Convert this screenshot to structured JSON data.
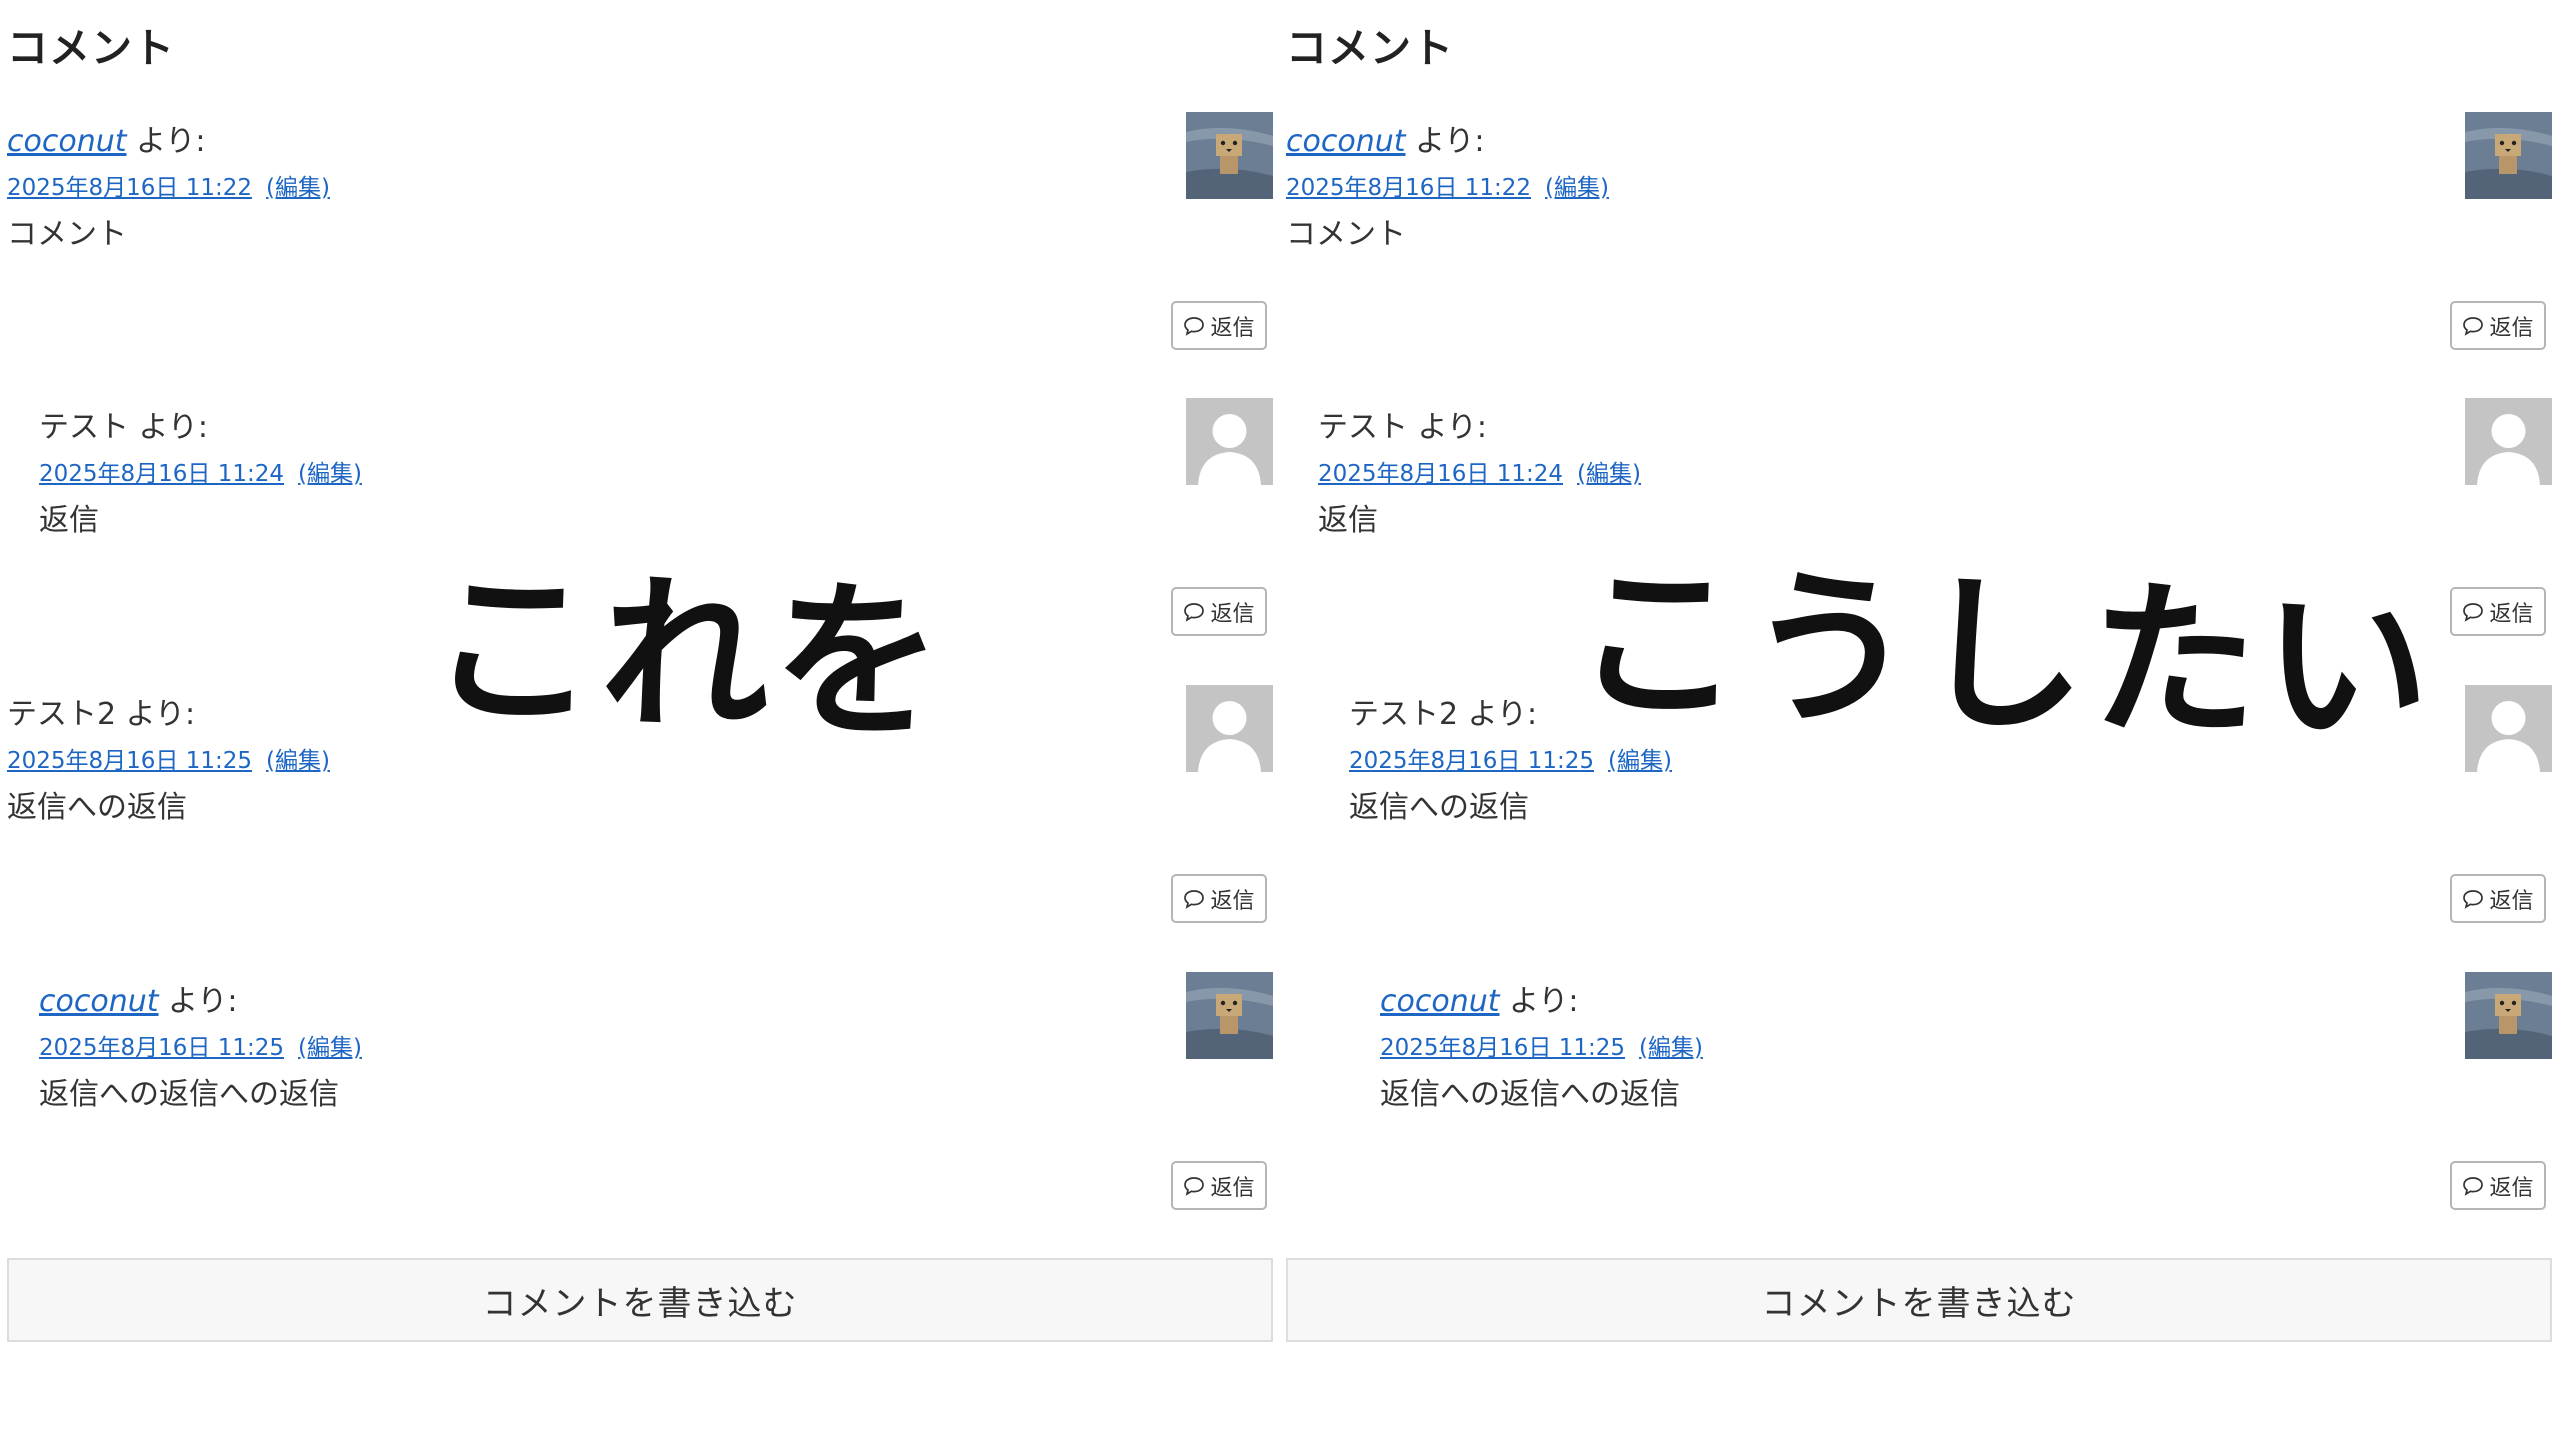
{
  "panels": [
    {
      "section_title": "コメント",
      "comments": [
        {
          "author": "coconut",
          "author_linked": true,
          "suffix": " より:",
          "date": "2025年8月16日 11:22",
          "edit": "(編集)",
          "body": "コメント",
          "avatar": "danbo-photo",
          "reply": "返信"
        },
        {
          "author": "テスト",
          "author_linked": false,
          "suffix": " より:",
          "date": "2025年8月16日 11:24",
          "edit": "(編集)",
          "body": "返信",
          "avatar": "default-person",
          "reply": "返信"
        },
        {
          "author": "テスト2",
          "author_linked": false,
          "suffix": " より:",
          "date": "2025年8月16日 11:25",
          "edit": "(編集)",
          "body": "返信への返信",
          "avatar": "default-person",
          "reply": "返信"
        },
        {
          "author": "coconut",
          "author_linked": true,
          "suffix": " より:",
          "date": "2025年8月16日 11:25",
          "edit": "(編集)",
          "body": "返信への返信への返信",
          "avatar": "danbo-photo",
          "reply": "返信"
        }
      ],
      "write_comment": "コメントを書き込む",
      "overlay": "これを"
    },
    {
      "section_title": "コメント",
      "comments": [
        {
          "author": "coconut",
          "author_linked": true,
          "suffix": " より:",
          "date": "2025年8月16日 11:22",
          "edit": "(編集)",
          "body": "コメント",
          "avatar": "danbo-photo",
          "reply": "返信"
        },
        {
          "author": "テスト",
          "author_linked": false,
          "suffix": " より:",
          "date": "2025年8月16日 11:24",
          "edit": "(編集)",
          "body": "返信",
          "avatar": "default-person",
          "reply": "返信"
        },
        {
          "author": "テスト2",
          "author_linked": false,
          "suffix": " より:",
          "date": "2025年8月16日 11:25",
          "edit": "(編集)",
          "body": "返信への返信",
          "avatar": "default-person",
          "reply": "返信"
        },
        {
          "author": "coconut",
          "author_linked": true,
          "suffix": " より:",
          "date": "2025年8月16日 11:25",
          "edit": "(編集)",
          "body": "返信への返信への返信",
          "avatar": "danbo-photo",
          "reply": "返信"
        }
      ],
      "write_comment": "コメントを書き込む",
      "overlay": "こうしたい"
    }
  ],
  "colors": {
    "link": "#1e66c4",
    "text": "#333333",
    "button_border": "#b5b5b5"
  }
}
